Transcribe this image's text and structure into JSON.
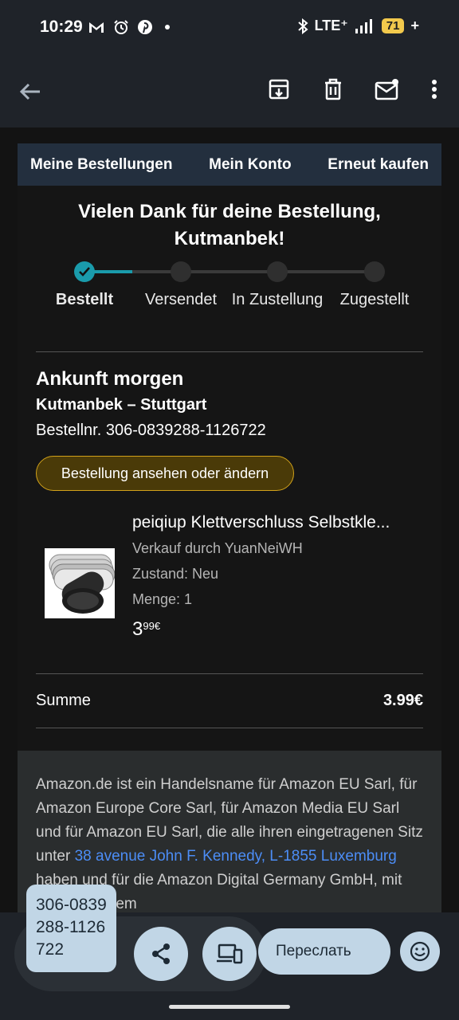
{
  "status_bar": {
    "time": "10:29",
    "network": "LTE⁺",
    "battery": "71",
    "left_icons": [
      "gmail-icon",
      "alarm-icon",
      "pinterest-icon",
      "dot-icon"
    ],
    "right_icons": [
      "bluetooth-icon",
      "signal-icon",
      "battery-icon"
    ]
  },
  "app_bar": {
    "icons": [
      "back-arrow-icon",
      "archive-icon",
      "delete-icon",
      "mark-unread-icon",
      "more-vert-icon"
    ]
  },
  "email": {
    "nav": [
      "Meine Bestellungen",
      "Mein Konto",
      "Erneut kaufen"
    ],
    "thanks": "Vielen Dank für deine Bestellung, Kutmanbek!",
    "tracker": {
      "steps": [
        {
          "label": "Bestellt",
          "done": true
        },
        {
          "label": "Versendet",
          "done": false
        },
        {
          "label": "In Zustellung",
          "done": false
        },
        {
          "label": "Zugestellt",
          "done": false
        }
      ],
      "progress_fraction": 0.12
    },
    "arrival": {
      "title": "Ankunft morgen",
      "recipient": "Kutmanbek – Stuttgart",
      "order_number": "Bestellnr. 306-0839288-1126722"
    },
    "order_button": "Bestellung ansehen oder ändern",
    "product": {
      "name": "peiqiup Klettverschluss Selbstkle...",
      "seller": "Verkauf durch YuanNeiWH",
      "condition": "Zustand: Neu",
      "quantity": "Menge: 1",
      "price_main": "3",
      "price_cents": "99€"
    },
    "summary": {
      "label": "Summe",
      "value": "3.99€"
    },
    "footer": {
      "text_1": "Amazon.de ist ein Handelsname für Amazon EU Sarl, für Amazon Europe Core Sarl, für Amazon Media EU Sarl und für Amazon EU Sarl, die alle ihren eingetragenen Sitz unter ",
      "link": "38 avenue John F. Kennedy, L-1855 Luxemburg",
      "text_2": " haben und für die Amazon Digital Germany GmbH, mit eingetragenem"
    }
  },
  "bottom_bar": {
    "tooltip": "306-0839288-1126722",
    "forward_label": "Переслать"
  },
  "colors": {
    "accent_teal": "#1a9bab",
    "nav_bg": "#232f3e",
    "button_gold": "#d2a21a",
    "link_blue": "#4c8df6",
    "battery_yellow": "#f2c94c",
    "bottom_button_bg": "#c1d6e6"
  }
}
